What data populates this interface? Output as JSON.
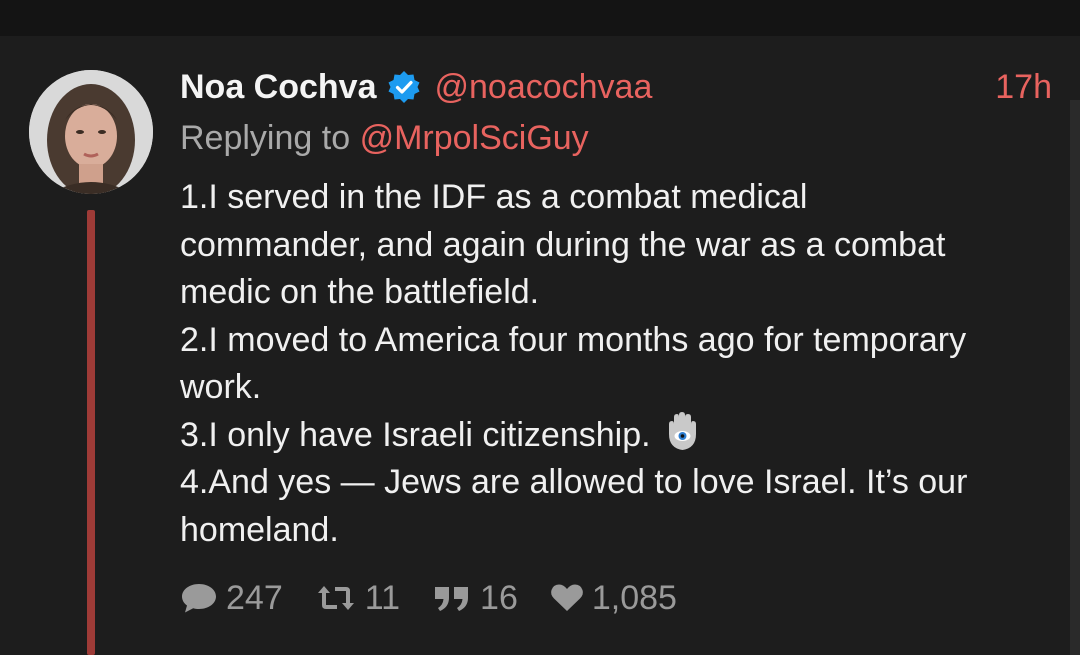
{
  "tweet": {
    "author_name": "Noa Cochva",
    "handle": "@noacochvaa",
    "time": "17h",
    "replying_prefix": "Replying to",
    "replying_to": "@MrpolSciGuy",
    "lines": {
      "l1": "1.I served in the IDF as a combat medical",
      "l2": "commander, and again during the war as a combat",
      "l3": "medic on the battlefield.",
      "l4": "2.I moved to America four months ago for temporary",
      "l5": "work.",
      "l6": "3.I only have Israeli citizenship.",
      "l7": "4.And yes — Jews are allowed to love Israel. It’s our",
      "l8": "homeland."
    },
    "emoji_icon": "hamsa-icon",
    "verified_icon": "verified-badge-icon",
    "stats": {
      "replies": "247",
      "retweets": "11",
      "quotes": "16",
      "likes": "1,085"
    }
  },
  "colors": {
    "accent": "#e8635f",
    "thread_line": "#9e3b37",
    "verified": "#1d9bf0",
    "background": "#1d1d1d"
  }
}
